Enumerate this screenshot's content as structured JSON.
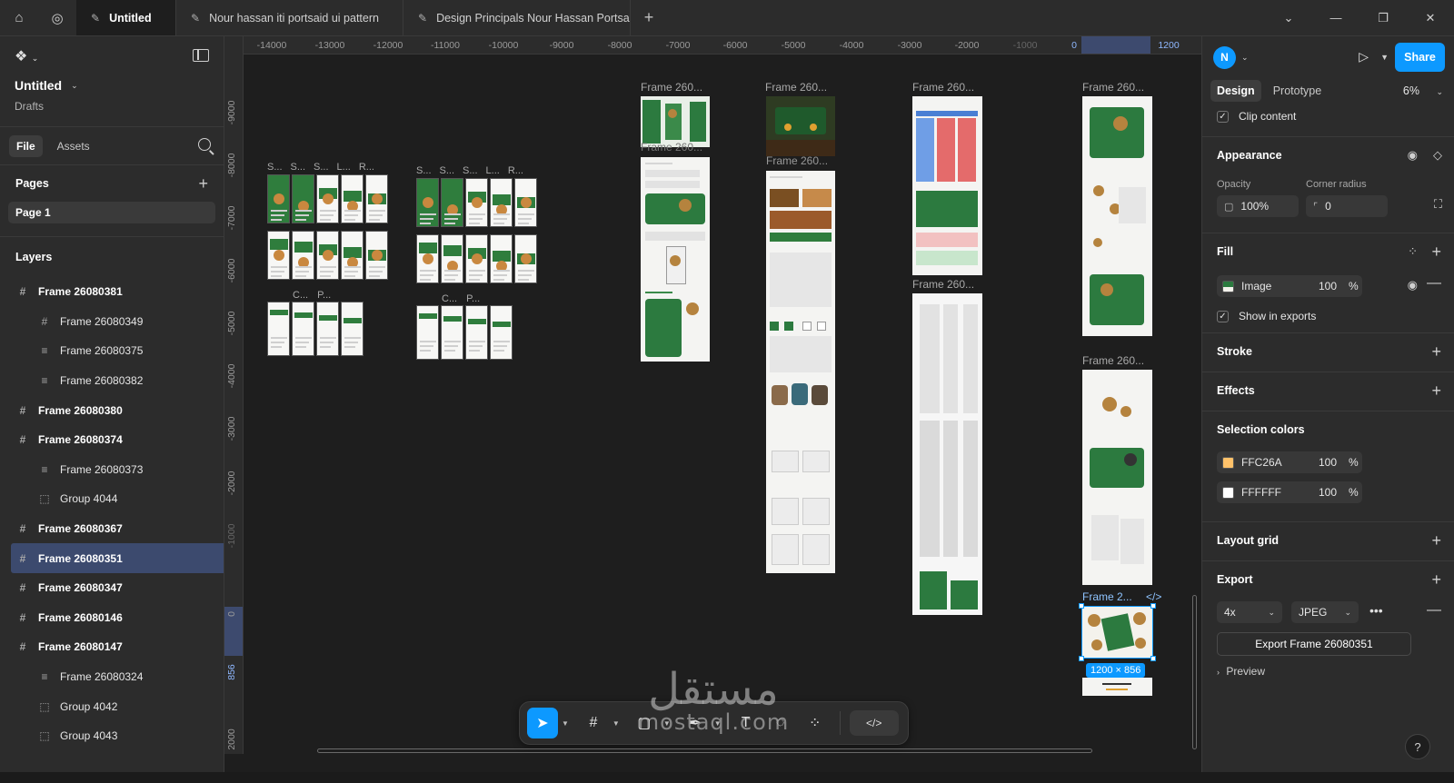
{
  "tabbar": {
    "home_icon": "home-icon",
    "globe_icon": "globe-icon",
    "tabs": [
      {
        "label": "Untitled",
        "active": true
      },
      {
        "label": "Nour hassan iti portsaid ui pattern",
        "active": false
      },
      {
        "label": "Design Principals Nour Hassan Portsa",
        "active": false
      }
    ],
    "close_glyph": "✕",
    "new_tab_glyph": "+"
  },
  "left_panel": {
    "file_title": "Untitled",
    "file_subtitle": "Drafts",
    "tabs": [
      "File",
      "Assets"
    ],
    "pages_header": "Pages",
    "pages": [
      "Page 1"
    ],
    "layers_header": "Layers",
    "layers": [
      {
        "name": "Frame 26080381",
        "level": "top",
        "icon": "frame"
      },
      {
        "name": "Frame 26080349",
        "level": "child",
        "icon": "frame"
      },
      {
        "name": "Frame 26080375",
        "level": "child",
        "icon": "autolayout"
      },
      {
        "name": "Frame 26080382",
        "level": "child",
        "icon": "autolayout"
      },
      {
        "name": "Frame 26080380",
        "level": "top",
        "icon": "frame"
      },
      {
        "name": "Frame 26080374",
        "level": "top",
        "icon": "frame"
      },
      {
        "name": "Frame 26080373",
        "level": "child",
        "icon": "autolayout"
      },
      {
        "name": "Group 4044",
        "level": "child",
        "icon": "group"
      },
      {
        "name": "Frame 26080367",
        "level": "top",
        "icon": "frame"
      },
      {
        "name": "Frame 26080351",
        "level": "top",
        "icon": "frame",
        "selected": true
      },
      {
        "name": "Frame 26080347",
        "level": "top",
        "icon": "frame"
      },
      {
        "name": "Frame 26080146",
        "level": "top",
        "icon": "frame"
      },
      {
        "name": "Frame 26080147",
        "level": "top",
        "icon": "frame"
      },
      {
        "name": "Frame 26080324",
        "level": "child",
        "icon": "autolayout"
      },
      {
        "name": "Group 4042",
        "level": "child",
        "icon": "group"
      },
      {
        "name": "Group 4043",
        "level": "child",
        "icon": "group"
      }
    ]
  },
  "rulers": {
    "top": [
      "-14000",
      "-13000",
      "-12000",
      "-11000",
      "-10000",
      "-9000",
      "-8000",
      "-7000",
      "-6000",
      "-5000",
      "-4000",
      "-3000",
      "-2000",
      "-1000",
      "0",
      "1200"
    ],
    "left": [
      "-9000",
      "-8000",
      "-7000",
      "-6000",
      "-5000",
      "-4000",
      "-3000",
      "-2000",
      "-1000",
      "0",
      "856",
      "2000"
    ]
  },
  "canvas": {
    "frame_labels": {
      "f1": "Frame 260...",
      "f1b": "Frame 260...",
      "f2": "Frame 260...",
      "f2b": "Frame 260...",
      "f3": "Frame 260...",
      "f3b": "Frame 260...",
      "f4": "Frame 260...",
      "f4b": "Frame 260...",
      "f5": "Frame 2..."
    },
    "mini_labels": [
      "S...",
      "S...",
      "S...",
      "L...",
      "R..."
    ],
    "mini_labels_b": [
      "C...",
      "P..."
    ],
    "selection_size": "1200 × 856",
    "code_glyph": "</>"
  },
  "watermark": {
    "arabic": "مستقل",
    "latin": "mostaql.com"
  },
  "right_panel": {
    "avatar_initial": "N",
    "share_label": "Share",
    "tabs": [
      "Design",
      "Prototype"
    ],
    "zoom": "6%",
    "clip_content": "Clip content",
    "appearance": {
      "header": "Appearance",
      "opacity_label": "Opacity",
      "opacity": "100%",
      "corner_label": "Corner radius",
      "corner": "0"
    },
    "fill": {
      "header": "Fill",
      "type": "Image",
      "opacity": "100",
      "pct": "%",
      "show_exports": "Show in exports"
    },
    "stroke_header": "Stroke",
    "effects_header": "Effects",
    "selection_colors": {
      "header": "Selection colors",
      "colors": [
        {
          "hex": "FFC26A",
          "opacity": "100",
          "swatch": "#FFC26A"
        },
        {
          "hex": "FFFFFF",
          "opacity": "100",
          "swatch": "#FFFFFF"
        }
      ],
      "pct": "%"
    },
    "layout_grid_header": "Layout grid",
    "export": {
      "header": "Export",
      "scale": "4x",
      "format": "JPEG",
      "button": "Export Frame 26080351",
      "preview": "Preview"
    },
    "help": "?"
  },
  "colors": {
    "accent": "#0d99ff",
    "panel": "#2c2c2c",
    "canvas": "#1e1e1e",
    "brand_green": "#2c7a3f"
  }
}
